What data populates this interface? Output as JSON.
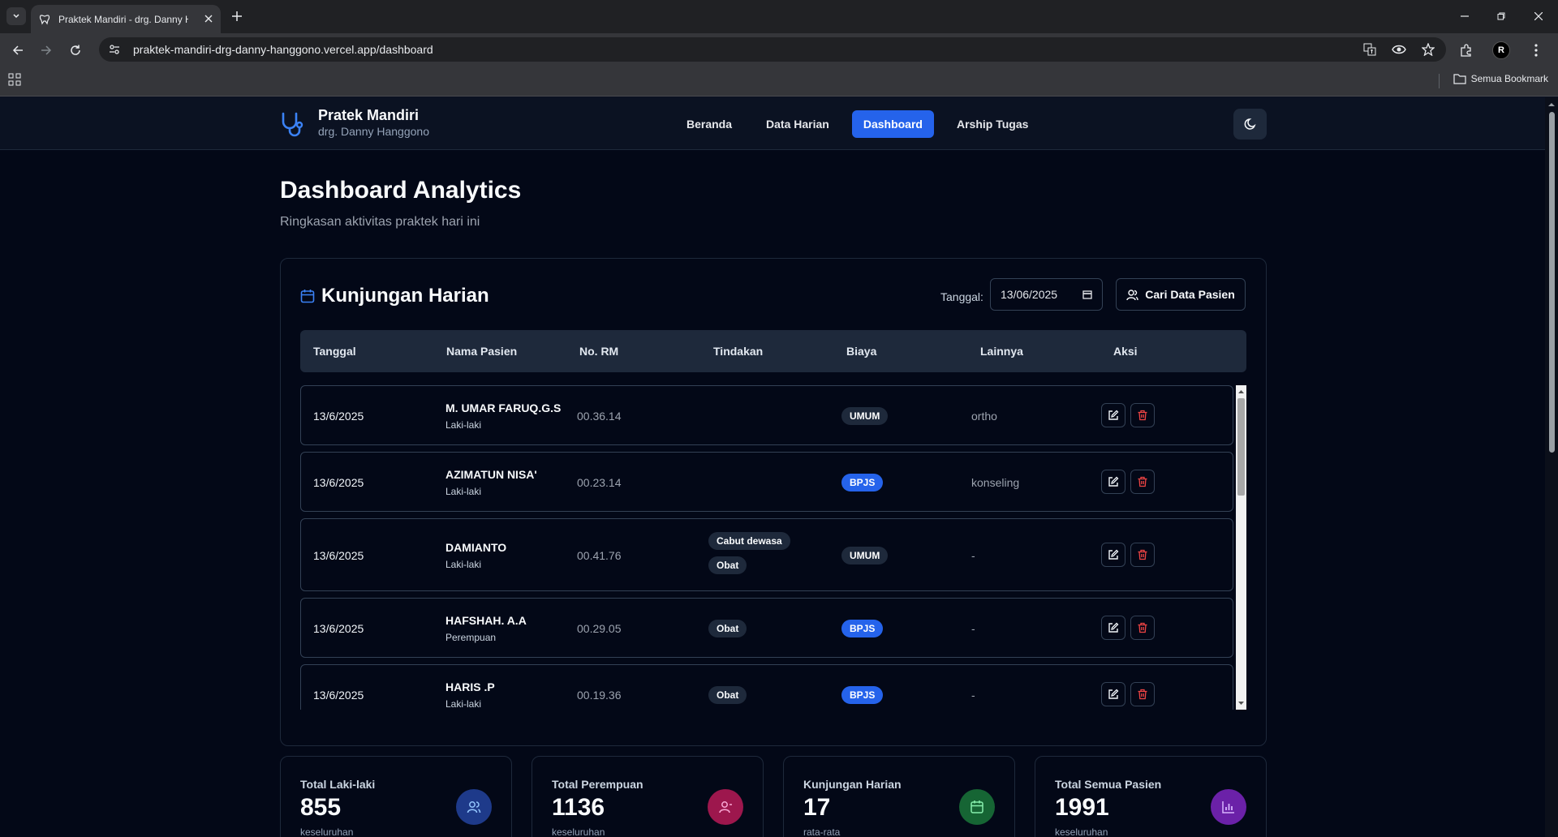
{
  "browser": {
    "tab_title": "Praktek Mandiri - drg. Danny H",
    "url": "praktek-mandiri-drg-danny-hanggono.vercel.app/dashboard",
    "bookmark_all": "Semua Bookmark",
    "avatar_letter": "R"
  },
  "app": {
    "brand_title": "Pratek Mandiri",
    "brand_sub": "drg. Danny Hanggono",
    "nav": [
      "Beranda",
      "Data Harian",
      "Dashboard",
      "Arship Tugas"
    ],
    "active_nav": "Dashboard"
  },
  "page": {
    "title": "Dashboard Analytics",
    "subtitle": "Ringkasan aktivitas praktek hari ini"
  },
  "visits": {
    "title": "Kunjungan Harian",
    "date_label": "Tanggal:",
    "date_value": "13/06/2025",
    "search_button": "Cari Data Pasien",
    "columns": [
      "Tanggal",
      "Nama Pasien",
      "No. RM",
      "Tindakan",
      "Biaya",
      "Lainnya",
      "Aksi"
    ],
    "rows": [
      {
        "date": "13/6/2025",
        "name": "M. UMAR FARUQ.G.S",
        "gender": "Laki-laki",
        "rm": "00.36.14",
        "actions": [],
        "fee": "UMUM",
        "other": "ortho"
      },
      {
        "date": "13/6/2025",
        "name": "AZIMATUN NISA'",
        "gender": "Laki-laki",
        "rm": "00.23.14",
        "actions": [],
        "fee": "BPJS",
        "other": "konseling"
      },
      {
        "date": "13/6/2025",
        "name": "DAMIANTO",
        "gender": "Laki-laki",
        "rm": "00.41.76",
        "actions": [
          "Cabut dewasa",
          "Obat"
        ],
        "fee": "UMUM",
        "other": "-"
      },
      {
        "date": "13/6/2025",
        "name": "HAFSHAH. A.A",
        "gender": "Perempuan",
        "rm": "00.29.05",
        "actions": [
          "Obat"
        ],
        "fee": "BPJS",
        "other": "-"
      },
      {
        "date": "13/6/2025",
        "name": "HARIS .P",
        "gender": "Laki-laki",
        "rm": "00.19.36",
        "actions": [
          "Obat"
        ],
        "fee": "BPJS",
        "other": "-"
      }
    ]
  },
  "stats": [
    {
      "label": "Total Laki-laki",
      "value": "855",
      "note": "keseluruhan",
      "icon": "users-icon",
      "color": "#1e3a8a"
    },
    {
      "label": "Total Perempuan",
      "value": "1136",
      "note": "keseluruhan",
      "icon": "user-female-icon",
      "color": "#9d174d"
    },
    {
      "label": "Kunjungan Harian",
      "value": "17",
      "note": "rata-rata",
      "icon": "calendar-icon",
      "color": "#166534"
    },
    {
      "label": "Total Semua Pasien",
      "value": "1991",
      "note": "keseluruhan",
      "icon": "bar-chart-icon",
      "color": "#6b21a8"
    }
  ]
}
